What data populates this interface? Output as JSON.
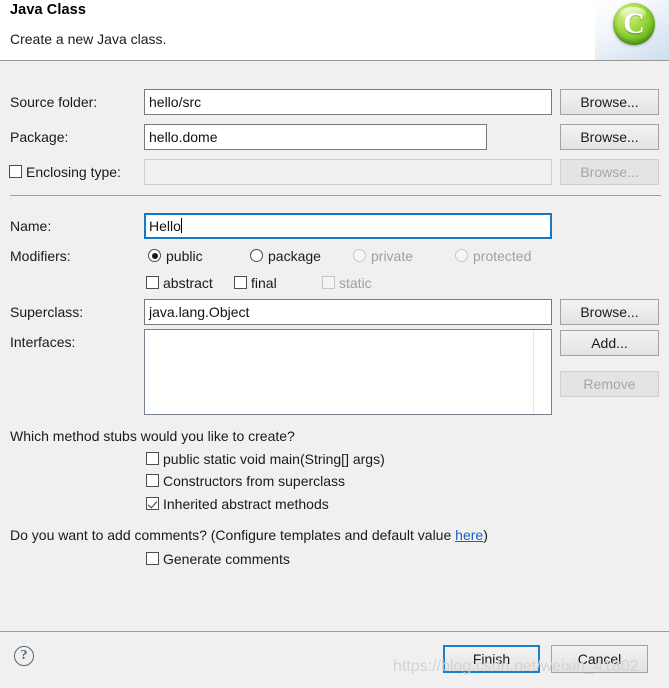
{
  "header": {
    "title": "Java Class",
    "subtitle": "Create a new Java class.",
    "icon": "java-class-wizard-icon",
    "icon_glyph": "C",
    "icon_color": "#71bf23"
  },
  "form": {
    "source_folder": {
      "label": "Source folder:",
      "value": "hello/src",
      "placeholder": "",
      "browse_label": "Browse...",
      "browse_enabled": true
    },
    "package": {
      "label": "Package:",
      "value": "hello.dome",
      "placeholder": "",
      "browse_label": "Browse...",
      "browse_enabled": true
    },
    "enclosing_type": {
      "label": "Enclosing type:",
      "checked": false,
      "value": "",
      "placeholder": "",
      "enabled": false,
      "browse_label": "Browse...",
      "browse_enabled": false
    },
    "name": {
      "label": "Name:",
      "value": "Hello",
      "placeholder": "",
      "focused": true
    },
    "modifiers": {
      "label": "Modifiers:",
      "access": [
        {
          "label": "public",
          "selected": true,
          "enabled": true
        },
        {
          "label": "package",
          "selected": false,
          "enabled": true
        },
        {
          "label": "private",
          "selected": false,
          "enabled": false
        },
        {
          "label": "protected",
          "selected": false,
          "enabled": false
        }
      ],
      "flags": [
        {
          "label": "abstract",
          "checked": false,
          "enabled": true
        },
        {
          "label": "final",
          "checked": false,
          "enabled": true
        },
        {
          "label": "static",
          "checked": false,
          "enabled": false
        }
      ]
    },
    "superclass": {
      "label": "Superclass:",
      "value": "java.lang.Object",
      "placeholder": "",
      "browse_label": "Browse...",
      "browse_enabled": true
    },
    "interfaces": {
      "label": "Interfaces:",
      "items": [],
      "add_label": "Add...",
      "add_enabled": true,
      "remove_label": "Remove",
      "remove_enabled": false
    }
  },
  "stubs": {
    "question": "Which method stubs would you like to create?",
    "options": [
      {
        "label": "public static void main(String[] args)",
        "checked": false
      },
      {
        "label": "Constructors from superclass",
        "checked": false
      },
      {
        "label": "Inherited abstract methods",
        "checked": true
      }
    ]
  },
  "comments": {
    "question_prefix": "Do you want to add comments? (Configure templates and default value ",
    "link_label": "here",
    "question_suffix": ")",
    "option": {
      "label": "Generate comments",
      "checked": false
    }
  },
  "footer": {
    "help_label": "?",
    "finish_label": "Finish",
    "cancel_label": "Cancel",
    "default_button": "Finish"
  },
  "watermark": {
    "text": "https://blog.csdn.net/weixin_41802"
  }
}
